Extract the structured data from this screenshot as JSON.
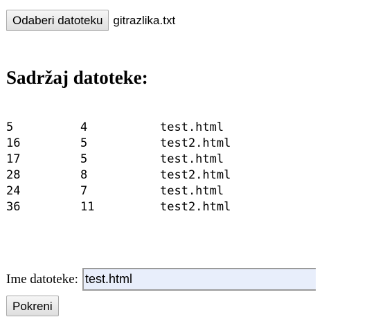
{
  "file_picker": {
    "button_label": "Odaberi datoteku",
    "selected_file": "gitrazlika.txt"
  },
  "heading": "Sadržaj datoteke:",
  "file_lines": [
    [
      "5",
      "4",
      "test.html"
    ],
    [
      "16",
      "5",
      "test2.html"
    ],
    [
      "17",
      "5",
      "test.html"
    ],
    [
      "28",
      "8",
      "test2.html"
    ],
    [
      "24",
      "7",
      "test.html"
    ],
    [
      "36",
      "11",
      "test2.html"
    ]
  ],
  "name_field": {
    "label": "Ime datoteke:",
    "value": "test.html"
  },
  "run_button_label": "Pokreni"
}
